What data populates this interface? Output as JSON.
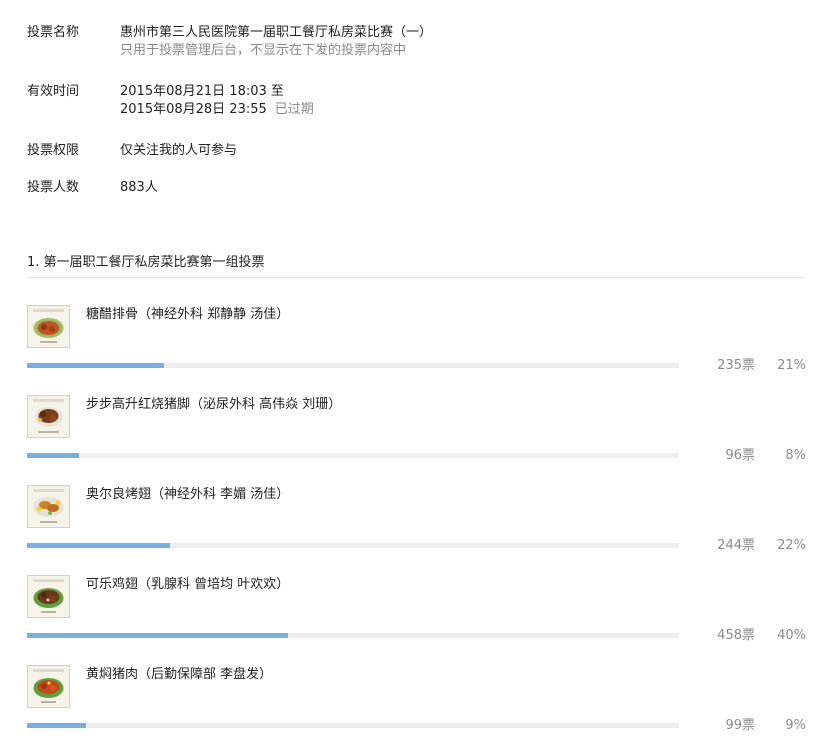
{
  "vote_info": {
    "name": {
      "label": "投票名称",
      "value": "惠州市第三人民医院第一届职工餐厅私房菜比赛（一）",
      "note": "只用于投票管理后台，不显示在下发的投票内容中"
    },
    "valid_time": {
      "label": "有效时间",
      "start": "2015年08月21日 18:03 至",
      "end": "2015年08月28日 23:55",
      "status": "已过期"
    },
    "permission": {
      "label": "投票权限",
      "value": "仅关注我的人可参与"
    },
    "participants": {
      "label": "投票人数",
      "value": "883人"
    }
  },
  "question": {
    "title": "1. 第一届职工餐厅私房菜比赛第一组投票",
    "options": [
      {
        "label": "糖醋排骨（神经外科 郑静静 汤佳）",
        "votes": "235票",
        "percent_text": "21%",
        "percent": 21,
        "thumb_icon": "sweet-sour-ribs-photo",
        "thumb_caption": "糖醋排骨"
      },
      {
        "label": "步步高升红烧猪脚（泌尿外科 高伟焱 刘珊）",
        "votes": "96票",
        "percent_text": "8%",
        "percent": 8,
        "thumb_icon": "braised-trotters-photo",
        "thumb_caption": "步步高升红烧猪脚"
      },
      {
        "label": "奥尔良烤翅（神经外科 李媚 汤佳）",
        "votes": "244票",
        "percent_text": "22%",
        "percent": 22,
        "thumb_icon": "orleans-wings-photo",
        "thumb_caption": "奥尔良烤翅"
      },
      {
        "label": "可乐鸡翅（乳腺科 曾培均 叶欢欢）",
        "votes": "458票",
        "percent_text": "40%",
        "percent": 40,
        "thumb_icon": "cola-wings-photo",
        "thumb_caption": "可乐鸡翅"
      },
      {
        "label": "黄焖猪肉（后勤保障部 李盘发）",
        "votes": "99票",
        "percent_text": "9%",
        "percent": 9,
        "thumb_icon": "stewed-pork-photo",
        "thumb_caption": "黄焖猪肉"
      }
    ]
  },
  "colors": {
    "bar_fill": "#7aaee0",
    "bar_track": "#eeeeee",
    "muted_text": "#8a8a8a",
    "text": "#222222"
  }
}
